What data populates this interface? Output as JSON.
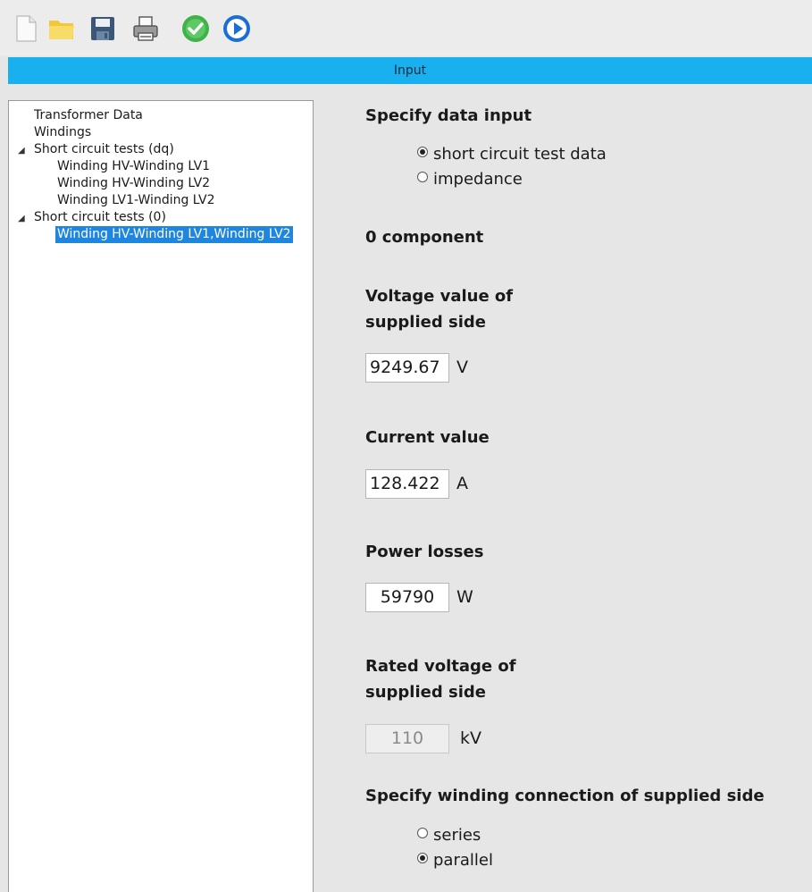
{
  "toolbar": {
    "buttons": [
      {
        "icon": "new-file-icon",
        "label": "New"
      },
      {
        "icon": "open-folder-icon",
        "label": "Open"
      },
      {
        "icon": "save-icon",
        "label": "Save"
      },
      {
        "icon": "print-icon",
        "label": "Print"
      },
      {
        "icon": "check-icon",
        "label": "Check"
      },
      {
        "icon": "run-icon",
        "label": "Run"
      }
    ]
  },
  "header": {
    "title": "Input"
  },
  "tree": {
    "items": [
      {
        "label": "Transformer Data"
      },
      {
        "label": "Windings"
      },
      {
        "label": "Short circuit tests (dq)",
        "expanded": true
      },
      {
        "label": "Winding HV-Winding LV1"
      },
      {
        "label": "Winding HV-Winding LV2"
      },
      {
        "label": "Winding LV1-Winding LV2"
      },
      {
        "label": "Short circuit tests (0)",
        "expanded": true
      },
      {
        "label": "Winding HV-Winding LV1,Winding LV2",
        "selected": true
      }
    ]
  },
  "form": {
    "data_input": {
      "heading": "Specify data input",
      "options": [
        "short circuit test data",
        "impedance"
      ],
      "selected": "short circuit test data"
    },
    "component_heading": "0 component",
    "voltage": {
      "heading_line1": "Voltage value of",
      "heading_line2": "supplied side",
      "value": "9249.67",
      "unit": "V"
    },
    "current": {
      "heading": "Current value",
      "value": "128.422",
      "unit": "A"
    },
    "power_losses": {
      "heading": "Power losses",
      "value": "59790",
      "unit": "W"
    },
    "rated_voltage": {
      "heading_line1": "Rated voltage of",
      "heading_line2": "supplied side",
      "value": "110",
      "unit": "kV"
    },
    "winding_connection": {
      "heading": "Specify winding connection of supplied side",
      "options": [
        "series",
        "parallel"
      ],
      "selected": "parallel"
    }
  },
  "colors": {
    "header_bar": "#19b0f0",
    "selection": "#1f86e0",
    "background": "#e6e6e6"
  }
}
